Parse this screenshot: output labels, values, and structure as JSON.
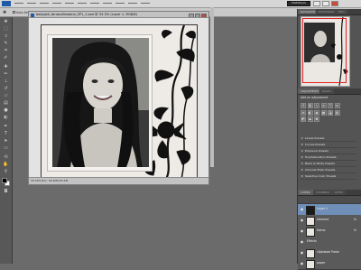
{
  "options_bar": {
    "auto_select_label": "Auto-Select:",
    "auto_select_value": "Layer",
    "show_transform_label": "Show Transform Controls"
  },
  "workspace": {
    "essentials_label": "ESSENTIALS"
  },
  "document": {
    "title": "babyjwk_tanasullisioana_0P1_1.psd @ 33.3% (Layer 1, RGB/8)",
    "zoom": "33.33%",
    "doc_info": "Doc: 30.4M/103.1M"
  },
  "navigator": {
    "tabs": [
      "NAVIGATOR",
      "HISTOGRAM",
      "INFO"
    ]
  },
  "adjustments": {
    "tabs": [
      "ADJUSTMENTS",
      "MASKS"
    ],
    "title": "Add an adjustment",
    "presets": [
      "Levels Presets",
      "Curves Presets",
      "Exposure Presets",
      "Hue/Saturation Presets",
      "Black & White Presets",
      "Channel Mixer Presets",
      "Selective Color Presets"
    ]
  },
  "layers": {
    "tabs": [
      "LAYERS",
      "CHANNELS",
      "PATHS"
    ],
    "items": [
      {
        "name": "Layer 1",
        "selected": true,
        "fx": false
      },
      {
        "name": "element",
        "selected": false,
        "fx": true
      },
      {
        "name": "frame",
        "selected": false,
        "fx": true
      },
      {
        "name": "Effects",
        "selected": false,
        "fx": false
      },
      {
        "name": "clipbeball Paste",
        "selected": false,
        "fx": false
      },
      {
        "name": "paper",
        "selected": false,
        "fx": false
      }
    ]
  }
}
